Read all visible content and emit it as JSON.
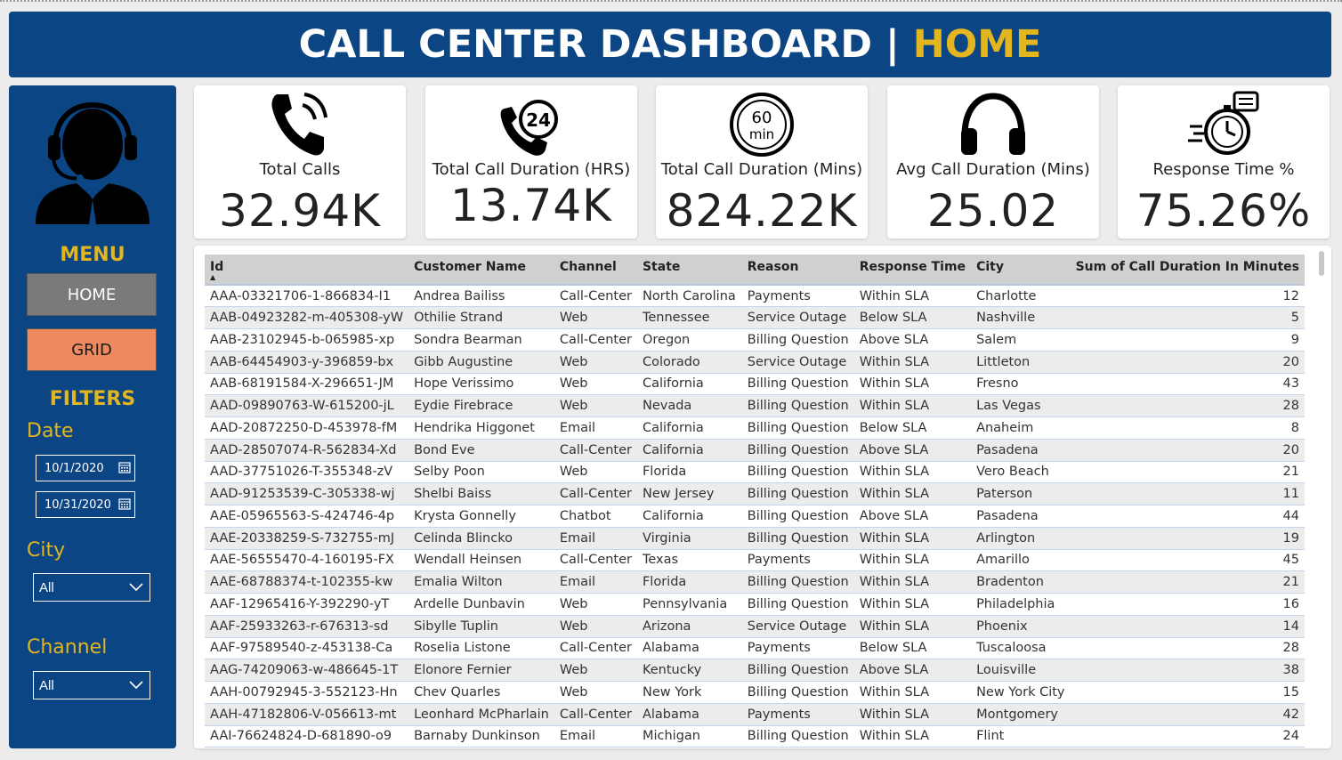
{
  "header": {
    "title_main": "CALL CENTER DASHBOARD | ",
    "title_accent": "HOME"
  },
  "colors": {
    "brand": "#0b4583",
    "accent": "#e3b51f",
    "home_button": "#7a7a7a",
    "grid_button": "#ef8a5e"
  },
  "sidebar": {
    "avatar_icon": "agent-headset-icon",
    "menu_title": "MENU",
    "nav": {
      "home": "HOME",
      "grid": "GRID"
    },
    "filters_title": "FILTERS",
    "date_label": "Date",
    "date_start": "10/1/2020",
    "date_end": "10/31/2020",
    "city_label": "City",
    "city_value": "All",
    "channel_label": "Channel",
    "channel_value": "All"
  },
  "kpis": [
    {
      "icon": "phone-ringing-icon",
      "label": "Total Calls",
      "value": "32.94K"
    },
    {
      "icon": "phone-24-icon",
      "label": "Total Call Duration (HRS)",
      "value": "13.74K"
    },
    {
      "icon": "timer-60-min-icon",
      "label": "Total Call Duration (Mins)",
      "value": "824.22K"
    },
    {
      "icon": "headphones-icon",
      "label": "Avg Call Duration (Mins)",
      "value": "25.02"
    },
    {
      "icon": "stopwatch-response-icon",
      "label": "Response Time %",
      "value": "75.26%"
    }
  ],
  "table": {
    "columns": [
      "Id",
      "Customer Name",
      "Channel",
      "State",
      "Reason",
      "Response Time",
      "City",
      "Sum of Call Duration In Minutes"
    ],
    "rows": [
      [
        "AAA-03321706-1-866834-I1",
        "Andrea Bailiss",
        "Call-Center",
        "North Carolina",
        "Payments",
        "Within SLA",
        "Charlotte",
        "12"
      ],
      [
        "AAB-04923282-m-405308-yW",
        "Othilie Strand",
        "Web",
        "Tennessee",
        "Service Outage",
        "Below SLA",
        "Nashville",
        "5"
      ],
      [
        "AAB-23102945-b-065985-xp",
        "Sondra Bearman",
        "Call-Center",
        "Oregon",
        "Billing Question",
        "Above SLA",
        "Salem",
        "9"
      ],
      [
        "AAB-64454903-y-396859-bx",
        "Gibb Augustine",
        "Web",
        "Colorado",
        "Service Outage",
        "Within SLA",
        "Littleton",
        "20"
      ],
      [
        "AAB-68191584-X-296651-JM",
        "Hope Verissimo",
        "Web",
        "California",
        "Billing Question",
        "Within SLA",
        "Fresno",
        "43"
      ],
      [
        "AAD-09890763-W-615200-jL",
        "Eydie Firebrace",
        "Web",
        "Nevada",
        "Billing Question",
        "Within SLA",
        "Las Vegas",
        "28"
      ],
      [
        "AAD-20872250-D-453978-fM",
        "Hendrika Higgonet",
        "Email",
        "California",
        "Billing Question",
        "Below SLA",
        "Anaheim",
        "8"
      ],
      [
        "AAD-28507074-R-562834-Xd",
        "Bond Eve",
        "Call-Center",
        "California",
        "Billing Question",
        "Above SLA",
        "Pasadena",
        "20"
      ],
      [
        "AAD-37751026-T-355348-zV",
        "Selby Poon",
        "Web",
        "Florida",
        "Billing Question",
        "Within SLA",
        "Vero Beach",
        "21"
      ],
      [
        "AAD-91253539-C-305338-wj",
        "Shelbi Baiss",
        "Call-Center",
        "New Jersey",
        "Billing Question",
        "Within SLA",
        "Paterson",
        "11"
      ],
      [
        "AAE-05965563-S-424746-4p",
        "Krysta Gonnelly",
        "Chatbot",
        "California",
        "Billing Question",
        "Above SLA",
        "Pasadena",
        "44"
      ],
      [
        "AAE-20338259-S-732755-mJ",
        "Celinda Blincko",
        "Email",
        "Virginia",
        "Billing Question",
        "Within SLA",
        "Arlington",
        "19"
      ],
      [
        "AAE-56555470-4-160195-FX",
        "Wendall Heinsen",
        "Call-Center",
        "Texas",
        "Payments",
        "Within SLA",
        "Amarillo",
        "45"
      ],
      [
        "AAE-68788374-t-102355-kw",
        "Emalia Wilton",
        "Email",
        "Florida",
        "Billing Question",
        "Within SLA",
        "Bradenton",
        "21"
      ],
      [
        "AAF-12965416-Y-392290-yT",
        "Ardelle Dunbavin",
        "Web",
        "Pennsylvania",
        "Billing Question",
        "Within SLA",
        "Philadelphia",
        "16"
      ],
      [
        "AAF-25933263-r-676313-sd",
        "Sibylle Tuplin",
        "Web",
        "Arizona",
        "Service Outage",
        "Within SLA",
        "Phoenix",
        "14"
      ],
      [
        "AAF-97589540-z-453138-Ca",
        "Roselia Listone",
        "Call-Center",
        "Alabama",
        "Payments",
        "Below SLA",
        "Tuscaloosa",
        "28"
      ],
      [
        "AAG-74209063-w-486645-1T",
        "Elonore Fernier",
        "Web",
        "Kentucky",
        "Billing Question",
        "Above SLA",
        "Louisville",
        "38"
      ],
      [
        "AAH-00792945-3-552123-Hn",
        "Chev Quarles",
        "Web",
        "New York",
        "Billing Question",
        "Within SLA",
        "New York City",
        "15"
      ],
      [
        "AAH-47182806-V-056613-mt",
        "Leonhard McPharlain",
        "Call-Center",
        "Alabama",
        "Payments",
        "Within SLA",
        "Montgomery",
        "42"
      ],
      [
        "AAI-76624824-D-681890-o9",
        "Barnaby Dunkinson",
        "Email",
        "Michigan",
        "Billing Question",
        "Within SLA",
        "Flint",
        "24"
      ]
    ]
  }
}
